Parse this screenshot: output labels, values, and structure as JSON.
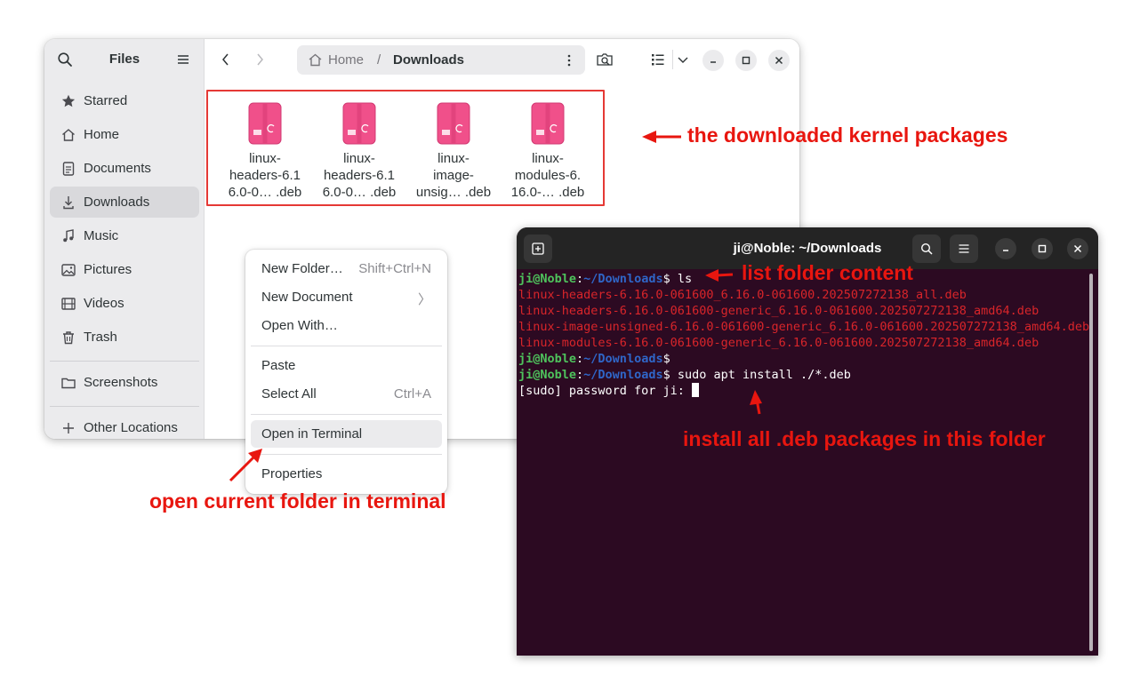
{
  "files_window": {
    "title": "Files",
    "sidebar": {
      "items": [
        {
          "label": "Starred",
          "icon": "star-icon"
        },
        {
          "label": "Home",
          "icon": "home-icon"
        },
        {
          "label": "Documents",
          "icon": "document-icon"
        },
        {
          "label": "Downloads",
          "icon": "download-icon",
          "active": true
        },
        {
          "label": "Music",
          "icon": "music-icon"
        },
        {
          "label": "Pictures",
          "icon": "picture-icon"
        },
        {
          "label": "Videos",
          "icon": "video-icon"
        },
        {
          "label": "Trash",
          "icon": "trash-icon"
        }
      ],
      "bookmarks": [
        {
          "label": "Screenshots",
          "icon": "folder-icon"
        }
      ],
      "other": {
        "label": "Other Locations",
        "icon": "plus-icon"
      }
    },
    "pathbar": {
      "home": "Home",
      "separator": "/",
      "current": "Downloads"
    },
    "files": [
      {
        "line1": "linux-",
        "line2": "headers-6.1",
        "line3": "6.0-0… .deb"
      },
      {
        "line1": "linux-",
        "line2": "headers-6.1",
        "line3": "6.0-0… .deb"
      },
      {
        "line1": "linux-",
        "line2": "image-",
        "line3": "unsig… .deb"
      },
      {
        "line1": "linux-",
        "line2": "modules-6.",
        "line3": "16.0-… .deb"
      }
    ]
  },
  "context_menu": {
    "new_folder": {
      "label": "New Folder…",
      "shortcut": "Shift+Ctrl+N"
    },
    "new_document": {
      "label": "New Document",
      "submenu": "〉"
    },
    "open_with": {
      "label": "Open With…"
    },
    "paste": {
      "label": "Paste"
    },
    "select_all": {
      "label": "Select All",
      "shortcut": "Ctrl+A"
    },
    "open_in_terminal": {
      "label": "Open in Terminal"
    },
    "properties": {
      "label": "Properties"
    }
  },
  "terminal": {
    "title": "ji@Noble: ~/Downloads",
    "prompt_user": "ji@Noble",
    "prompt_colon": ":",
    "prompt_path": "~/Downloads",
    "prompt_dollar": "$",
    "cmd1": " ls",
    "ls_output": [
      "linux-headers-6.16.0-061600_6.16.0-061600.202507272138_all.deb",
      "linux-headers-6.16.0-061600-generic_6.16.0-061600.202507272138_amd64.deb",
      "linux-image-unsigned-6.16.0-061600-generic_6.16.0-061600.202507272138_amd64.deb",
      "linux-modules-6.16.0-061600-generic_6.16.0-061600.202507272138_amd64.deb"
    ],
    "cmd2": "",
    "cmd3": " sudo apt install ./*.deb",
    "sudo_prompt": "[sudo] password for ji: "
  },
  "annotations": {
    "packages": "the downloaded kernel packages",
    "list": "list folder content",
    "install": "install all .deb packages in this folder",
    "open_terminal": "open current folder in terminal"
  },
  "colors": {
    "annotation": "#e8160f",
    "terminal_bg": "#2c0a22",
    "deb_icon": "#f0508a"
  }
}
